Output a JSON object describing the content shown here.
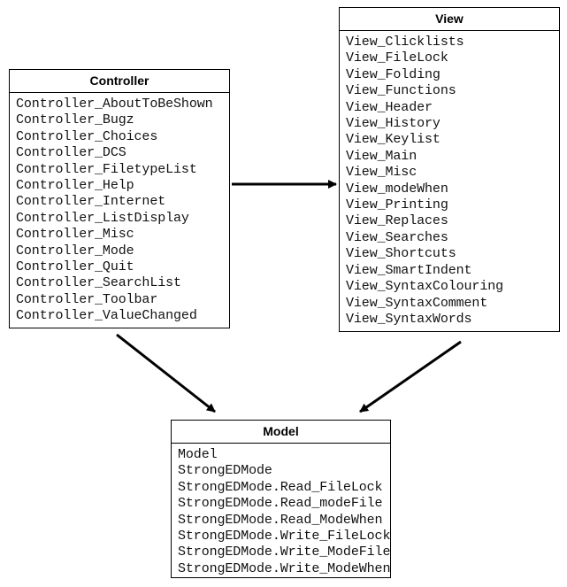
{
  "controller": {
    "title": "Controller",
    "items": [
      "Controller_AboutToBeShown",
      "Controller_Bugz",
      "Controller_Choices",
      "Controller_DCS",
      "Controller_FiletypeList",
      "Controller_Help",
      "Controller_Internet",
      "Controller_ListDisplay",
      "Controller_Misc",
      "Controller_Mode",
      "Controller_Quit",
      "Controller_SearchList",
      "Controller_Toolbar",
      "Controller_ValueChanged"
    ]
  },
  "view": {
    "title": "View",
    "items": [
      "View_Clicklists",
      "View_FileLock",
      "View_Folding",
      "View_Functions",
      "View_Header",
      "View_History",
      "View_Keylist",
      "View_Main",
      "View_Misc",
      "View_modeWhen",
      "View_Printing",
      "View_Replaces",
      "View_Searches",
      "View_Shortcuts",
      "View_SmartIndent",
      "View_SyntaxColouring",
      "View_SyntaxComment",
      "View_SyntaxWords"
    ]
  },
  "model": {
    "title": "Model",
    "items": [
      "Model",
      "StrongEDMode",
      "StrongEDMode.Read_FileLock",
      "StrongEDMode.Read_modeFile",
      "StrongEDMode.Read_ModeWhen",
      "StrongEDMode.Write_FileLock",
      "StrongEDMode.Write_ModeFile",
      "StrongEDMode.Write_ModeWhen"
    ]
  },
  "arrows": [
    {
      "from": "controller",
      "to": "view"
    },
    {
      "from": "controller",
      "to": "model"
    },
    {
      "from": "view",
      "to": "model"
    }
  ]
}
